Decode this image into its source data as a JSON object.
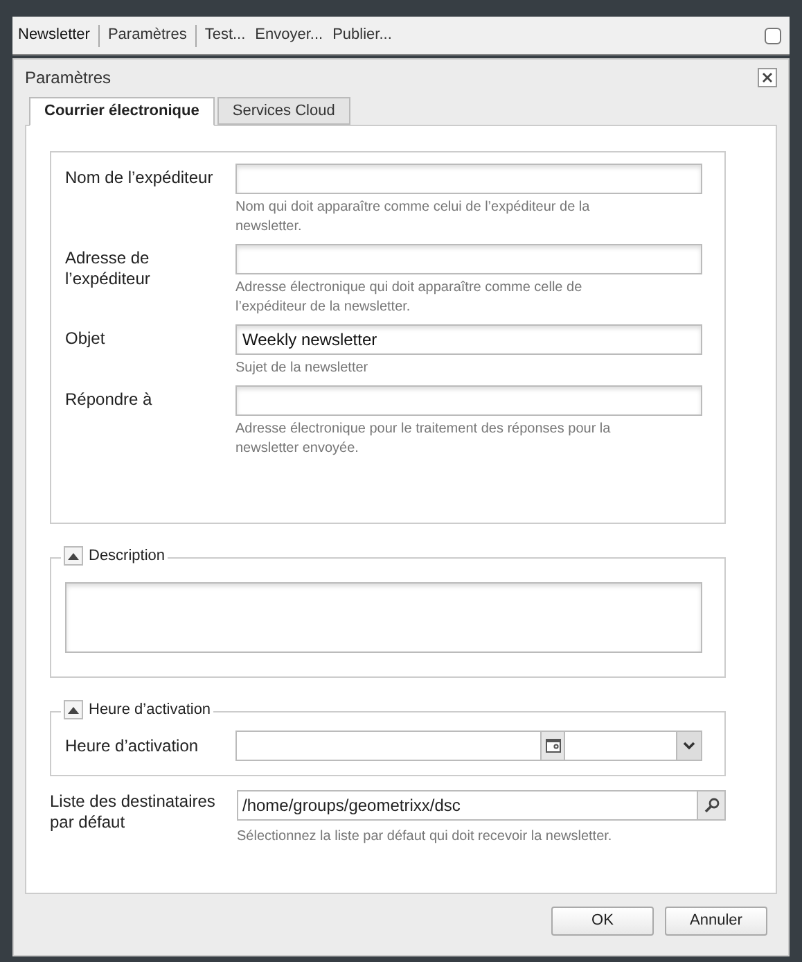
{
  "toolbar": {
    "groups": [
      [
        "Newsletter"
      ],
      [
        "Paramètres"
      ],
      [
        "Test...",
        "Envoyer...",
        "Publier..."
      ]
    ],
    "checked": false
  },
  "dialog": {
    "title": "Paramètres",
    "tabs": [
      {
        "label": "Courrier électronique",
        "selected": true
      },
      {
        "label": "Services Cloud",
        "selected": false
      }
    ],
    "fields": [
      {
        "label": "Nom de l’expéditeur",
        "help": "Nom qui doit apparaître comme celui de l’expéditeur de la newsletter."
      },
      {
        "label": "Adresse de l’expéditeur",
        "help": "Adresse électronique qui doit apparaître comme celle de l’expéditeur de la newsletter."
      },
      {
        "label": "Objet",
        "value": "Weekly newsletter",
        "help": "Sujet de la newsletter"
      },
      {
        "label": "Répondre à",
        "help": "Adresse électronique pour le traitement des réponses pour la newsletter envoyée."
      }
    ],
    "sections": [
      {
        "kind": "textarea",
        "title": "Description",
        "expanded": true
      },
      {
        "kind": "datetime",
        "title": "Heure d’activation",
        "expanded": true,
        "label": "Heure d’activation"
      }
    ],
    "recipients": {
      "label": "Liste des destinataires par défaut",
      "value": "/home/groups/geometrixx/dsc",
      "help": "Sélectionnez la liste par défaut qui doit recevoir la newsletter."
    },
    "buttons": [
      "OK",
      "Annuler"
    ]
  }
}
